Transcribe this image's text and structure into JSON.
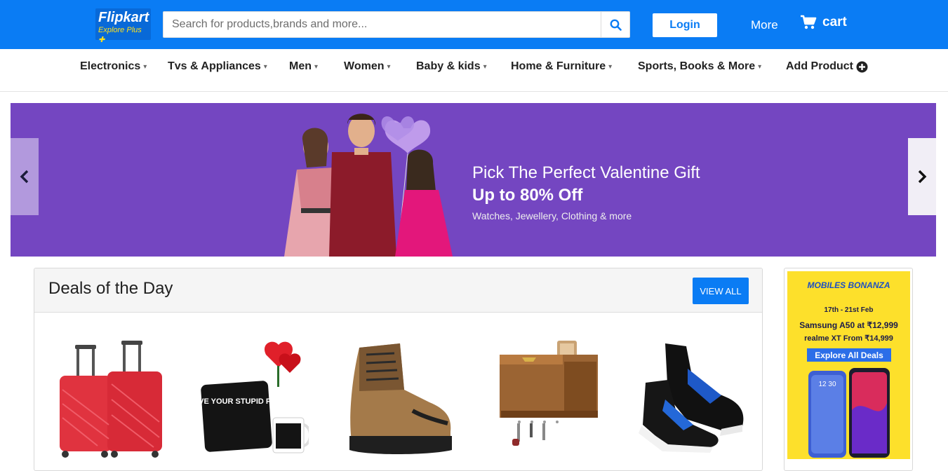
{
  "header": {
    "logo_main": "Flipkart",
    "logo_sub": "Explore Plus",
    "search_placeholder": "Search for products,brands and more...",
    "login_label": "Login",
    "more_label": "More",
    "cart_label": "cart"
  },
  "categories": [
    {
      "label": "Electronics",
      "has_dropdown": true
    },
    {
      "label": "Tvs & Appliances",
      "has_dropdown": true
    },
    {
      "label": "Men",
      "has_dropdown": true
    },
    {
      "label": "Women",
      "has_dropdown": true
    },
    {
      "label": "Baby & kids",
      "has_dropdown": true
    },
    {
      "label": "Home & Furniture",
      "has_dropdown": true
    },
    {
      "label": "Sports, Books & More",
      "has_dropdown": true
    },
    {
      "label": "Add Product",
      "has_dropdown": false,
      "icon": "plus-circle-icon"
    }
  ],
  "banner": {
    "title": "Pick The Perfect Valentine Gift",
    "offer": "Up to 80% Off",
    "subtitle": "Watches, Jewellery, Clothing & more"
  },
  "deals": {
    "title": "Deals of the Day",
    "view_all_label": "VIEW ALL",
    "items": [
      {
        "name": "trolley-luggage-set"
      },
      {
        "name": "valentine-cushion-mug-gift"
      },
      {
        "name": "leather-boots"
      },
      {
        "name": "wooden-key-holder"
      },
      {
        "name": "sports-shoes"
      }
    ],
    "gift_text": "I LOVE YOUR STUPID FACE"
  },
  "side_ad": {
    "brand": "MOBILES BONANZA",
    "dates": "17th - 21st Feb",
    "line1": "Samsung A50 at ₹12,999",
    "line2": "realme XT From ₹14,999",
    "cta": "Explore All Deals",
    "phone_time": "12 30"
  },
  "colors": {
    "brand_blue": "#0a7cf4",
    "banner_purple": "#7446c1",
    "ad_yellow": "#fde02b"
  }
}
